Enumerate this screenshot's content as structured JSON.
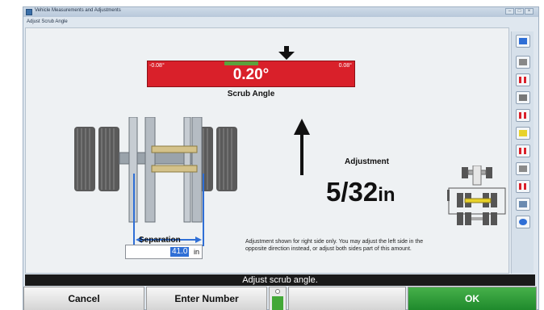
{
  "window": {
    "title": "Vehicle Measurements and Adjustments",
    "subtitle": "Adjust Scrub Angle",
    "controls": [
      "–",
      "□",
      "×"
    ]
  },
  "gauge": {
    "left_limit": "-0.08°",
    "right_limit": "0.08°",
    "value": "0.20°",
    "caption": "Scrub Angle",
    "colors": {
      "bar": "#d9202a",
      "in_spec_zone": "#5aa23c"
    }
  },
  "adjustment": {
    "title": "Adjustment",
    "value": "5/32",
    "unit": "in"
  },
  "separation": {
    "label": "Separation",
    "value": "41.0",
    "unit": "in"
  },
  "note": "Adjustment shown for right side only.  You may adjust the left side in the opposite direction instead, or adjust both sides part of this amount.",
  "toolbar": {
    "icons": [
      "help-icon",
      "camber-icon",
      "checker-flag-icon",
      "wrench-icon",
      "checker-flag-icon",
      "axle-icon",
      "checker-flag-icon",
      "vehicle-icon",
      "checker-flag-icon",
      "steering-icon",
      "globe-icon"
    ]
  },
  "status": "Adjust scrub angle.",
  "buttons": {
    "cancel": "Cancel",
    "enter_number": "Enter Number",
    "blank": "",
    "ok": "OK"
  },
  "colors": {
    "ok_button": "#2f9a36",
    "selection": "#2f6fd6"
  }
}
